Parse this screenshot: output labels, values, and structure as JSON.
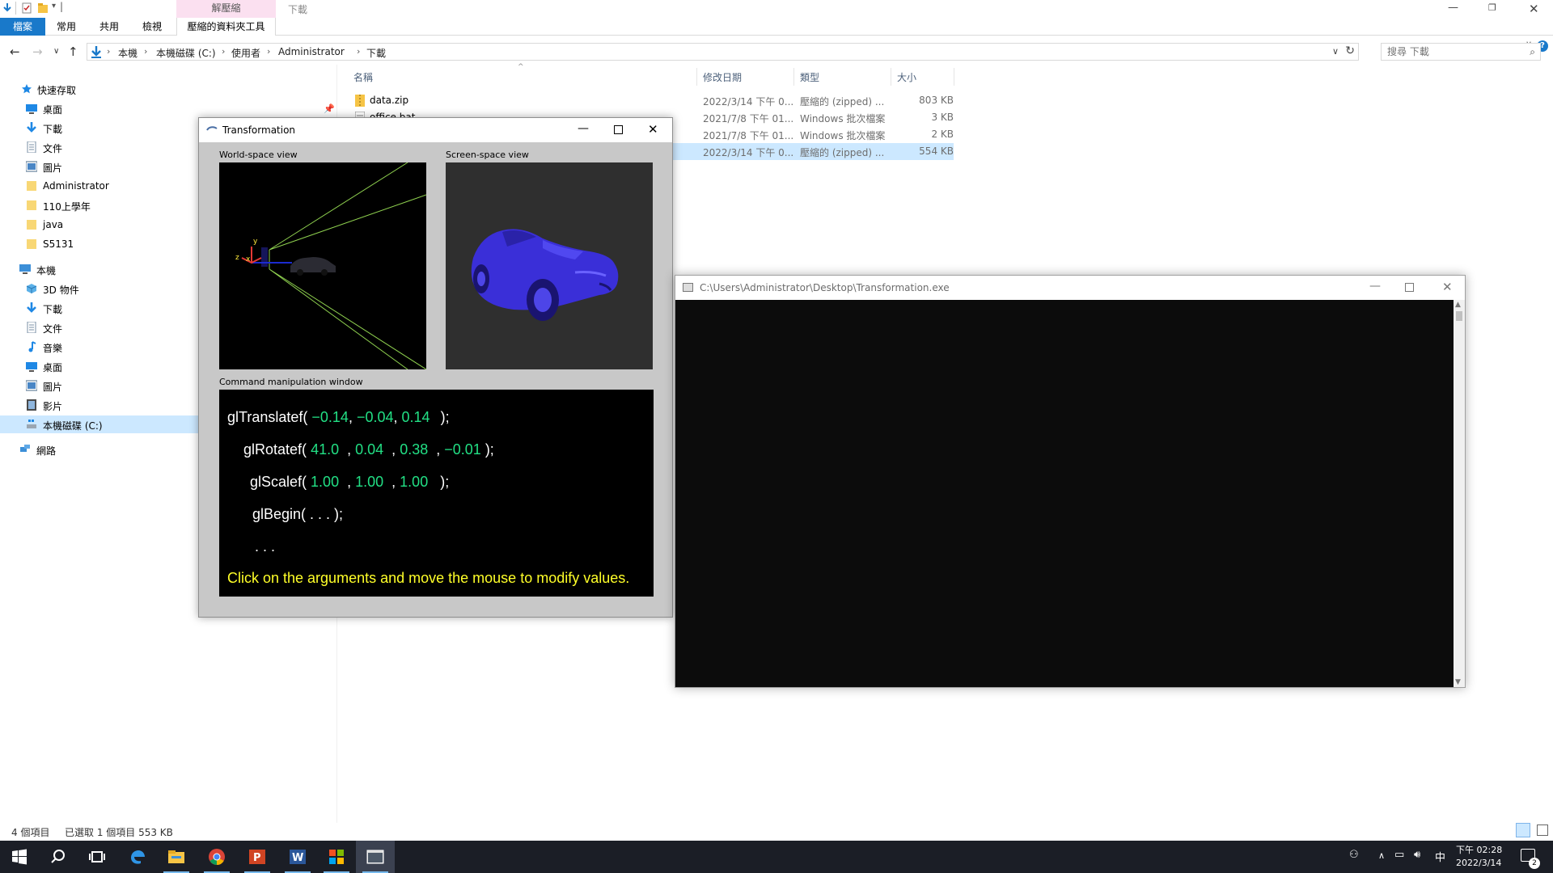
{
  "explorer": {
    "ribbon": {
      "tab_file": "檔案",
      "tab_home": "常用",
      "tab_share": "共用",
      "tab_view": "檢視",
      "context_group": "解壓縮",
      "context_tab": "壓縮的資料夾工具",
      "window_title": "下載"
    },
    "address": {
      "crumbs": [
        "本機",
        "本機磁碟 (C:)",
        "使用者",
        "Administrator",
        "下載"
      ]
    },
    "search": {
      "placeholder": "搜尋 下載"
    },
    "nav": {
      "quick_access": "快速存取",
      "items": [
        "桌面",
        "下載",
        "文件",
        "圖片",
        "Administrator",
        "110上學年",
        "java",
        "S5131"
      ],
      "this_pc": "本機",
      "pc_items": [
        "3D 物件",
        "下載",
        "文件",
        "音樂",
        "桌面",
        "圖片",
        "影片",
        "本機磁碟 (C:)"
      ],
      "network": "網路"
    },
    "columns": {
      "name": "名稱",
      "date": "修改日期",
      "type": "類型",
      "size": "大小"
    },
    "files": [
      {
        "name": "data.zip",
        "date": "2022/3/14 下午 0...",
        "type": "壓縮的 (zipped) ...",
        "size": "803 KB"
      },
      {
        "name": "office.bat",
        "date": "2021/7/8 下午 01...",
        "type": "Windows 批次檔案",
        "size": "3 KB"
      },
      {
        "name": "",
        "date": "2021/7/8 下午 01...",
        "type": "Windows 批次檔案",
        "size": "2 KB"
      },
      {
        "name": "",
        "date": "2022/3/14 下午 0...",
        "type": "壓縮的 (zipped) ...",
        "size": "554 KB"
      }
    ],
    "status": {
      "count": "4 個項目",
      "selected": "已選取 1 個項目  553 KB"
    }
  },
  "transformation": {
    "title": "Transformation",
    "world_label": "World-space view",
    "screen_label": "Screen-space view",
    "command_label": "Command manipulation window",
    "axes": {
      "y": "y",
      "z": "z",
      "x": "x"
    },
    "translate": {
      "fn": "glTranslatef(",
      "args": [
        "−0.14",
        "−0.04",
        "0.14"
      ],
      "end": ");"
    },
    "rotate": {
      "fn": "glRotatef(",
      "args": [
        "41.0",
        "0.04",
        "0.38",
        "−0.01"
      ],
      "end": ");"
    },
    "scale": {
      "fn": "glScalef(",
      "args": [
        "1.00",
        "1.00",
        "1.00"
      ],
      "end": ");"
    },
    "begin": "glBegin(  . . .  );",
    "ellipsis": ". . .",
    "hint": "Click on the arguments and move the mouse to modify values.",
    "colors": {
      "arg": "#22e085",
      "hint": "#ffff28",
      "car": "#3a2fd8"
    }
  },
  "console": {
    "title": "C:\\Users\\Administrator\\Desktop\\Transformation.exe"
  },
  "taskbar": {
    "apps": [
      "start-icon",
      "search-icon",
      "task-view-icon",
      "edge-icon",
      "file-explorer-icon",
      "chrome-icon",
      "powerpoint-icon",
      "word-icon",
      "visual-studio-icon",
      "console-icon"
    ],
    "ime": "中",
    "time": "下午 02:28",
    "date": "2022/3/14",
    "notifications": "2"
  }
}
